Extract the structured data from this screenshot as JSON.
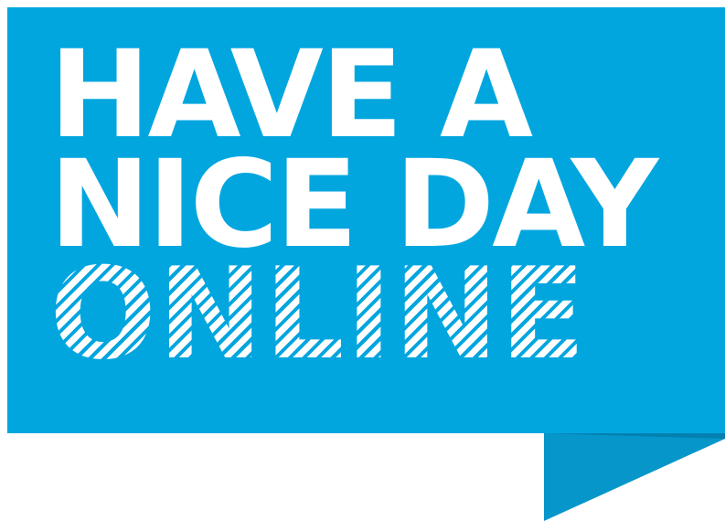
{
  "colors": {
    "banner": "#02a6df",
    "banner_fold": "#0696c9",
    "banner_fold_shadow": "#0380b0",
    "text": "#ffffff"
  },
  "headline": {
    "line1": "HAVE A",
    "line2": "NICE DAY",
    "line3": "ONLINE"
  }
}
